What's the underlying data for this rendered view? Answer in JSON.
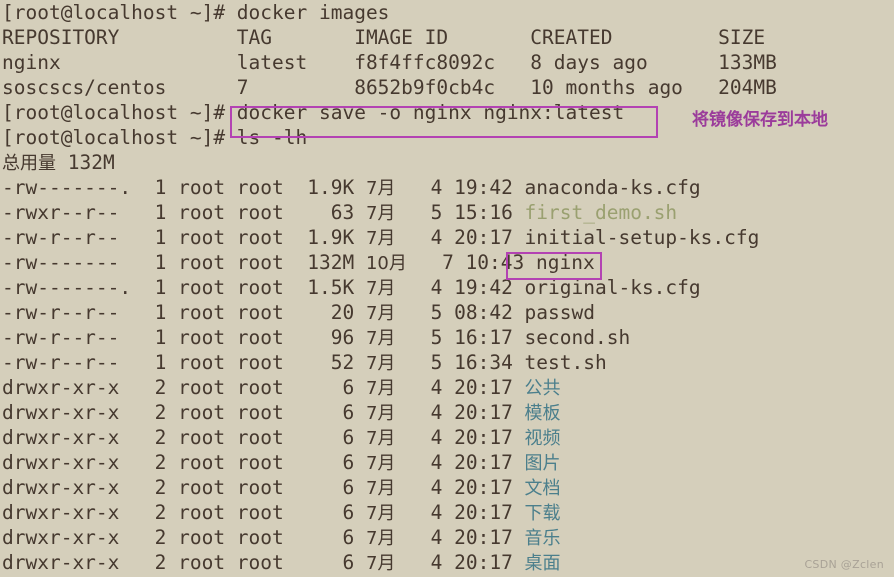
{
  "terminal": {
    "background_color": "#d5cfbb",
    "foreground_color": "#46392f",
    "dir_color": "#4b7f8c",
    "exec_color": "#9aa070",
    "accent_color": "#b342b3",
    "prompt": "[root@localhost ~]#",
    "partial_top_line": "",
    "lines": [
      {
        "id": "cmd-docker-images",
        "text": "[root@localhost ~]# docker images"
      },
      {
        "id": "images-header",
        "text": "REPOSITORY          TAG       IMAGE ID       CREATED         SIZE"
      },
      {
        "id": "images-row-nginx",
        "text": "nginx               latest    f8f4ffc8092c   8 days ago      133MB"
      },
      {
        "id": "images-row-centos",
        "text": "soscscs/centos      7         8652b9f0cb4c   10 months ago   204MB"
      },
      {
        "id": "cmd-docker-save",
        "text": "[root@localhost ~]# docker save -o nginx nginx:latest"
      },
      {
        "id": "cmd-ls-lh",
        "text": "[root@localhost ~]# ls -lh"
      }
    ]
  },
  "docker_images": {
    "command": "docker images",
    "columns": [
      "REPOSITORY",
      "TAG",
      "IMAGE ID",
      "CREATED",
      "SIZE"
    ],
    "rows": [
      {
        "repository": "nginx",
        "tag": "latest",
        "image_id": "f8f4ffc8092c",
        "created": "8 days ago",
        "size": "133MB"
      },
      {
        "repository": "soscscs/centos",
        "tag": "7",
        "image_id": "8652b9f0cb4c",
        "created": "10 months ago",
        "size": "204MB"
      }
    ]
  },
  "docker_save": {
    "command": "docker save -o nginx nginx:latest",
    "annotation": "将镜像保存到本地"
  },
  "listing": {
    "command": "ls -lh",
    "total_label": "总用量",
    "total_value": "132M",
    "rows": [
      {
        "perm": "-rw-------.",
        "links": "1",
        "owner": "root",
        "group": "root",
        "size": "1.9K",
        "month": "7月",
        "day": "4",
        "time": "19:42",
        "name": "anaconda-ks.cfg",
        "type": "file"
      },
      {
        "perm": "-rwxr--r--",
        "links": "1",
        "owner": "root",
        "group": "root",
        "size": "63",
        "month": "7月",
        "day": "5",
        "time": "15:16",
        "name": "first_demo.sh",
        "type": "exec"
      },
      {
        "perm": "-rw-r--r--",
        "links": "1",
        "owner": "root",
        "group": "root",
        "size": "1.9K",
        "month": "7月",
        "day": "4",
        "time": "20:17",
        "name": "initial-setup-ks.cfg",
        "type": "file"
      },
      {
        "perm": "-rw-------",
        "links": "1",
        "owner": "root",
        "group": "root",
        "size": "132M",
        "month": "10月",
        "day": "7",
        "time": "10:43",
        "name": "nginx",
        "type": "file"
      },
      {
        "perm": "-rw-------.",
        "links": "1",
        "owner": "root",
        "group": "root",
        "size": "1.5K",
        "month": "7月",
        "day": "4",
        "time": "19:42",
        "name": "original-ks.cfg",
        "type": "file"
      },
      {
        "perm": "-rw-r--r--",
        "links": "1",
        "owner": "root",
        "group": "root",
        "size": "20",
        "month": "7月",
        "day": "5",
        "time": "08:42",
        "name": "passwd",
        "type": "file"
      },
      {
        "perm": "-rw-r--r--",
        "links": "1",
        "owner": "root",
        "group": "root",
        "size": "96",
        "month": "7月",
        "day": "5",
        "time": "16:17",
        "name": "second.sh",
        "type": "file"
      },
      {
        "perm": "-rw-r--r--",
        "links": "1",
        "owner": "root",
        "group": "root",
        "size": "52",
        "month": "7月",
        "day": "5",
        "time": "16:34",
        "name": "test.sh",
        "type": "file"
      },
      {
        "perm": "drwxr-xr-x",
        "links": "2",
        "owner": "root",
        "group": "root",
        "size": "6",
        "month": "7月",
        "day": "4",
        "time": "20:17",
        "name": "公共",
        "type": "dir"
      },
      {
        "perm": "drwxr-xr-x",
        "links": "2",
        "owner": "root",
        "group": "root",
        "size": "6",
        "month": "7月",
        "day": "4",
        "time": "20:17",
        "name": "模板",
        "type": "dir"
      },
      {
        "perm": "drwxr-xr-x",
        "links": "2",
        "owner": "root",
        "group": "root",
        "size": "6",
        "month": "7月",
        "day": "4",
        "time": "20:17",
        "name": "视频",
        "type": "dir"
      },
      {
        "perm": "drwxr-xr-x",
        "links": "2",
        "owner": "root",
        "group": "root",
        "size": "6",
        "month": "7月",
        "day": "4",
        "time": "20:17",
        "name": "图片",
        "type": "dir"
      },
      {
        "perm": "drwxr-xr-x",
        "links": "2",
        "owner": "root",
        "group": "root",
        "size": "6",
        "month": "7月",
        "day": "4",
        "time": "20:17",
        "name": "文档",
        "type": "dir"
      },
      {
        "perm": "drwxr-xr-x",
        "links": "2",
        "owner": "root",
        "group": "root",
        "size": "6",
        "month": "7月",
        "day": "4",
        "time": "20:17",
        "name": "下载",
        "type": "dir"
      },
      {
        "perm": "drwxr-xr-x",
        "links": "2",
        "owner": "root",
        "group": "root",
        "size": "6",
        "month": "7月",
        "day": "4",
        "time": "20:17",
        "name": "音乐",
        "type": "dir"
      },
      {
        "perm": "drwxr-xr-x",
        "links": "2",
        "owner": "root",
        "group": "root",
        "size": "6",
        "month": "7月",
        "day": "4",
        "time": "20:17",
        "name": "桌面",
        "type": "dir"
      }
    ]
  },
  "watermark": {
    "text": "CSDN @Zclen"
  }
}
